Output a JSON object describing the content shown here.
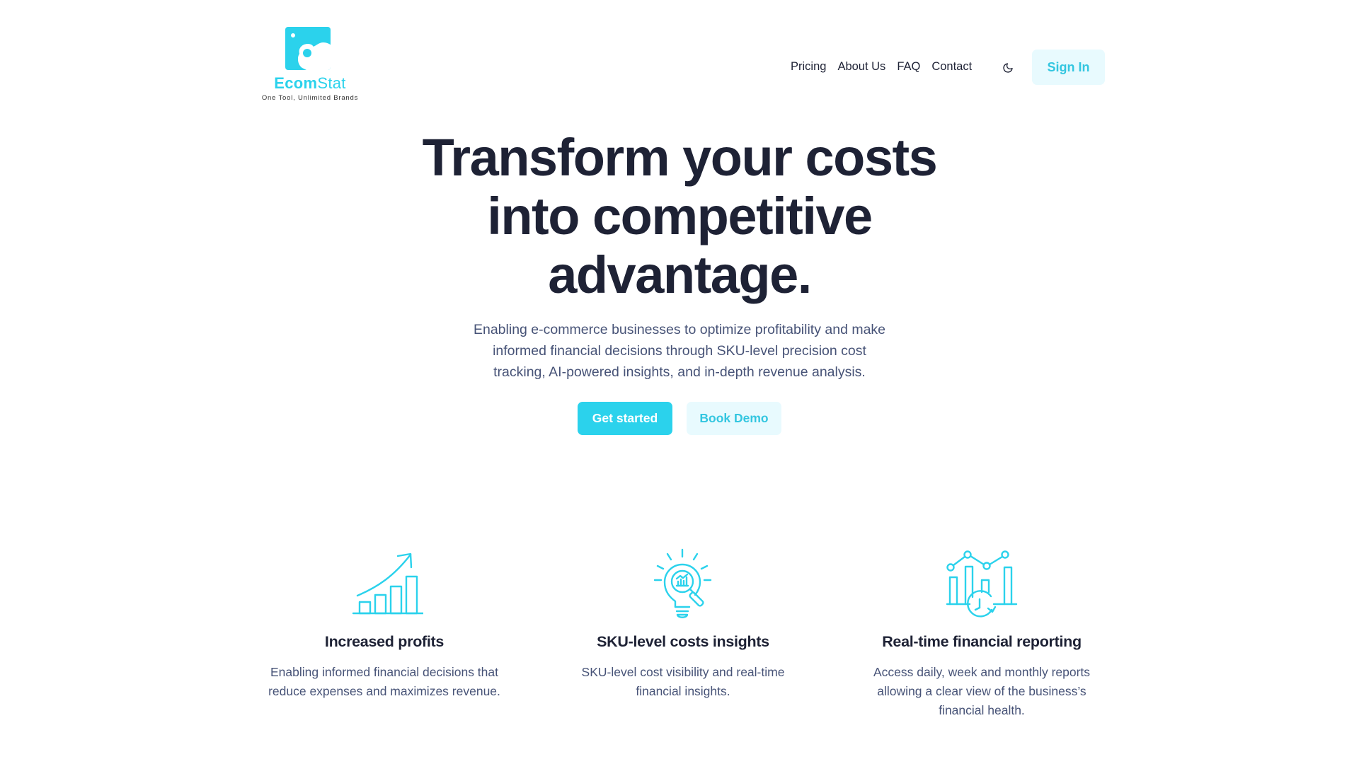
{
  "brand": {
    "name_bold": "Ecom",
    "name_light": "Stat",
    "tagline": "One Tool, Unlimited Brands",
    "accent_color": "#2bd2ec",
    "accent_light": "#e8fafe"
  },
  "nav": {
    "links": [
      {
        "label": "Pricing"
      },
      {
        "label": "About Us"
      },
      {
        "label": "FAQ"
      },
      {
        "label": "Contact"
      }
    ],
    "theme_toggle_icon": "moon-icon",
    "sign_in_label": "Sign In"
  },
  "hero": {
    "title_lines": [
      "Transform your costs",
      "into competitive",
      "advantage."
    ],
    "subtitle_lines": [
      "Enabling e-commerce businesses to optimize profitability and make",
      "informed financial decisions through SKU-level precision cost",
      "tracking, AI-powered insights, and in-depth revenue analysis."
    ],
    "primary_cta": "Get started",
    "secondary_cta": "Book Demo"
  },
  "features": [
    {
      "icon": "growth-chart-icon",
      "title": "Increased profits",
      "description_lines": [
        "Enabling informed financial decisions that",
        "reduce expenses and maximizes revenue."
      ]
    },
    {
      "icon": "lightbulb-analytics-icon",
      "title": "SKU-level costs insights",
      "description_lines": [
        "SKU-level cost visibility and real-time",
        "financial insights."
      ]
    },
    {
      "icon": "realtime-report-icon",
      "title": "Real-time financial reporting",
      "description_lines": [
        "Access daily, week and monthly reports",
        "allowing a clear view of the business’s",
        "financial health."
      ]
    }
  ]
}
